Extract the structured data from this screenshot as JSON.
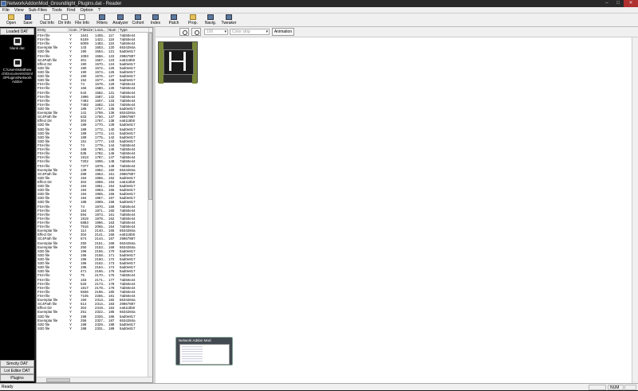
{
  "window": {
    "title": "NetworkAddonMod_Groundlight_Plugins.dat - Reader"
  },
  "menu": [
    "File",
    "View",
    "Sub-Files",
    "Tools",
    "Find",
    "Option",
    "?"
  ],
  "toolbar": [
    {
      "label": "Open",
      "icon": "folder-icon"
    },
    {
      "label": "Save",
      "icon": "save-icon"
    },
    {
      "label": "Dat Info",
      "icon": "dat-info-icon"
    },
    {
      "label": "Dir Info",
      "icon": "dir-info-icon"
    },
    {
      "label": "File Info",
      "icon": "file-info-icon"
    },
    {
      "label": "Filters",
      "icon": "filters-icon"
    },
    {
      "label": "Analyzer",
      "icon": "analyzer-icon"
    },
    {
      "label": "Cohort",
      "icon": "cohort-icon"
    },
    {
      "label": "Index",
      "icon": "index-icon"
    },
    {
      "label": "Patch",
      "icon": "patch-icon"
    },
    {
      "label": "Prop.",
      "icon": "prop-icon"
    },
    {
      "label": "Navig.",
      "icon": "navig-icon"
    },
    {
      "label": "Tweaker",
      "icon": "tweaker-icon"
    }
  ],
  "sidebar": {
    "top_button": "Loaded DAT",
    "items": [
      {
        "label": "blank dat"
      },
      {
        "label": "C:\\Users\\Matthew ch\\Documents\\Siml 4\\Plugins\\Network Addon"
      }
    ],
    "bottom_buttons": [
      "Simcity DAT",
      "Lot Editor DAT",
      "Plugins"
    ]
  },
  "list": {
    "columns": [
      "Entry",
      "Com.",
      "Filesize",
      "Loca...",
      "Num",
      "Type"
    ],
    "selected_index": 80,
    "rows": [
      [
        "FSH file",
        "Y",
        "1641",
        "1405...",
        "117",
        "7ab50e44"
      ],
      [
        "FSH file",
        "Y",
        "6159",
        "1422...",
        "118",
        "7ab50e44"
      ],
      [
        "FSH file",
        "Y",
        "6009",
        "1483...",
        "119",
        "7ab50e44"
      ],
      [
        "Exemplar file",
        "Y",
        "143",
        "1553...",
        "120",
        "6534284a"
      ],
      [
        "S3D file",
        "Y",
        "190",
        "1554...",
        "121",
        "5ad0e817"
      ],
      [
        "FSH file",
        "Y",
        "1093",
        "1556...",
        "122",
        "29867887"
      ],
      [
        "SC4Path file",
        "Y",
        "301",
        "1567...",
        "123",
        "ea5118b0"
      ],
      [
        "Effect Dir",
        "Y",
        "190",
        "1570...",
        "124",
        "5ad0e817"
      ],
      [
        "S3D file",
        "Y",
        "190",
        "1572...",
        "125",
        "5ad0e817"
      ],
      [
        "S3D file",
        "Y",
        "190",
        "1574...",
        "126",
        "5ad0e817"
      ],
      [
        "S3D file",
        "Y",
        "190",
        "1576...",
        "127",
        "5ad0e817"
      ],
      [
        "S3D file",
        "Y",
        "152",
        "1577...",
        "128",
        "5ad0e817"
      ],
      [
        "FSH file",
        "Y",
        "74",
        "1579...",
        "129",
        "7ab50e44"
      ],
      [
        "FSH file",
        "Y",
        "166",
        "1580...",
        "130",
        "7ab50e44"
      ],
      [
        "FSH file",
        "Y",
        "543",
        "1582...",
        "131",
        "7ab50e44"
      ],
      [
        "FSH file",
        "Y",
        "1996",
        "1587...",
        "132",
        "7ab50e44"
      ],
      [
        "FSH file",
        "Y",
        "7492",
        "1607...",
        "133",
        "7ab50e44"
      ],
      [
        "FSH file",
        "Y",
        "7492",
        "1682...",
        "134",
        "7ab50e44"
      ],
      [
        "S3D file",
        "Y",
        "189",
        "1757...",
        "135",
        "5ad0e817"
      ],
      [
        "Exemplar file",
        "Y",
        "141",
        "1759...",
        "136",
        "6534284a"
      ],
      [
        "SC4Path file",
        "Y",
        "633",
        "1760...",
        "137",
        "29867887"
      ],
      [
        "Effect Dir",
        "Y",
        "304",
        "1767...",
        "138",
        "ea5118b0"
      ],
      [
        "S3D file",
        "Y",
        "189",
        "1770...",
        "139",
        "5ad0e817"
      ],
      [
        "S3D file",
        "Y",
        "189",
        "1772...",
        "140",
        "5ad0e817"
      ],
      [
        "S3D file",
        "Y",
        "189",
        "1773...",
        "141",
        "5ad0e817"
      ],
      [
        "S3D file",
        "Y",
        "189",
        "1775...",
        "142",
        "5ad0e817"
      ],
      [
        "S3D file",
        "Y",
        "151",
        "1777...",
        "143",
        "5ad0e817"
      ],
      [
        "FSH file",
        "Y",
        "74",
        "1779...",
        "144",
        "7ab50e44"
      ],
      [
        "FSH file",
        "Y",
        "168",
        "1780...",
        "145",
        "7ab50e44"
      ],
      [
        "FSH file",
        "Y",
        "535",
        "1782...",
        "146",
        "7ab50e44"
      ],
      [
        "FSH file",
        "Y",
        "1913",
        "1787...",
        "147",
        "7ab50e44"
      ],
      [
        "FSH file",
        "Y",
        "7202",
        "1806...",
        "148",
        "7ab50e44"
      ],
      [
        "FSH file",
        "Y",
        "7377",
        "1878...",
        "149",
        "7ab50e44"
      ],
      [
        "Exemplar file",
        "Y",
        "139",
        "1952...",
        "150",
        "6534284a"
      ],
      [
        "SC4Path file",
        "Y",
        "289",
        "1953...",
        "151",
        "29867887"
      ],
      [
        "S3D file",
        "Y",
        "194",
        "1956...",
        "152",
        "5ad0e817"
      ],
      [
        "Effect Dir",
        "Y",
        "304",
        "1959...",
        "153",
        "ea5118b0"
      ],
      [
        "S3D file",
        "Y",
        "194",
        "1961...",
        "154",
        "5ad0e817"
      ],
      [
        "S3D file",
        "Y",
        "194",
        "1963...",
        "155",
        "5ad0e817"
      ],
      [
        "S3D file",
        "Y",
        "194",
        "1965...",
        "156",
        "5ad0e817"
      ],
      [
        "S3D file",
        "Y",
        "194",
        "1967...",
        "157",
        "5ad0e817"
      ],
      [
        "S3D file",
        "Y",
        "188",
        "1969...",
        "158",
        "5ad0e817"
      ],
      [
        "FSH file",
        "Y",
        "74",
        "1970...",
        "159",
        "7ab50e44"
      ],
      [
        "FSH file",
        "Y",
        "164",
        "1971...",
        "160",
        "7ab50e44"
      ],
      [
        "FSH file",
        "Y",
        "594",
        "1973...",
        "161",
        "7ab50e44"
      ],
      [
        "FSH file",
        "Y",
        "1919",
        "1978...",
        "162",
        "7ab50e44"
      ],
      [
        "FSH file",
        "Y",
        "6883",
        "1996...",
        "163",
        "7ab50e44"
      ],
      [
        "FSH file",
        "Y",
        "7516",
        "2065...",
        "164",
        "7ab50e44"
      ],
      [
        "Exemplar file",
        "Y",
        "114",
        "2140...",
        "165",
        "6534284a"
      ],
      [
        "Effect Dir",
        "Y",
        "304",
        "2141...",
        "166",
        "ea5118b0"
      ],
      [
        "SC4Path file",
        "Y",
        "674",
        "2144...",
        "167",
        "29867887"
      ],
      [
        "Exemplar file",
        "Y",
        "250",
        "2151...",
        "168",
        "6534284a"
      ],
      [
        "Exemplar file",
        "Y",
        "250",
        "2153...",
        "169",
        "6534284a"
      ],
      [
        "S3D file",
        "Y",
        "196",
        "2156...",
        "170",
        "5ad0e817"
      ],
      [
        "S3D file",
        "Y",
        "196",
        "2158...",
        "171",
        "5ad0e817"
      ],
      [
        "S3D file",
        "Y",
        "196",
        "2160...",
        "172",
        "5ad0e817"
      ],
      [
        "S3D file",
        "Y",
        "196",
        "2162...",
        "173",
        "5ad0e817"
      ],
      [
        "S3D file",
        "Y",
        "196",
        "2164...",
        "174",
        "5ad0e817"
      ],
      [
        "S3D file",
        "Y",
        "471",
        "2166...",
        "175",
        "5ad0e817"
      ],
      [
        "FSH file",
        "Y",
        "75",
        "2170...",
        "176",
        "7ab50e44"
      ],
      [
        "FSH file",
        "Y",
        "163",
        "2171...",
        "177",
        "7ab50e44"
      ],
      [
        "FSH file",
        "Y",
        "520",
        "2173...",
        "178",
        "7ab50e44"
      ],
      [
        "FSH file",
        "Y",
        "1817",
        "2178...",
        "179",
        "7ab50e44"
      ],
      [
        "FSH file",
        "Y",
        "6836",
        "2196...",
        "180",
        "7ab50e44"
      ],
      [
        "FSH file",
        "Y",
        "7105",
        "2265...",
        "181",
        "7ab50e44"
      ],
      [
        "Exemplar file",
        "Y",
        "150",
        "2313...",
        "182",
        "6534284a"
      ],
      [
        "SC4Path file",
        "Y",
        "514",
        "2314...",
        "183",
        "29867887"
      ],
      [
        "Effect Dir",
        "Y",
        "304",
        "2319...",
        "184",
        "ea5118b0"
      ],
      [
        "Exemplar file",
        "Y",
        "251",
        "2322...",
        "185",
        "6534284a"
      ],
      [
        "S3D file",
        "Y",
        "198",
        "2325...",
        "186",
        "5ad0e817"
      ],
      [
        "Exemplar file",
        "Y",
        "256",
        "2327...",
        "187",
        "6534284a"
      ],
      [
        "S3D file",
        "Y",
        "198",
        "2329...",
        "188",
        "5ad0e817"
      ],
      [
        "S3D file",
        "Y",
        "198",
        "2331...",
        "189",
        "5ad0e817"
      ]
    ]
  },
  "main": {
    "zoom_select": "100",
    "color_select": "Color strip",
    "animation_button": "Animation"
  },
  "taskbar_popup": {
    "title": "Network Addon Mod"
  },
  "status": {
    "text": "Ready",
    "num": "NUM"
  }
}
